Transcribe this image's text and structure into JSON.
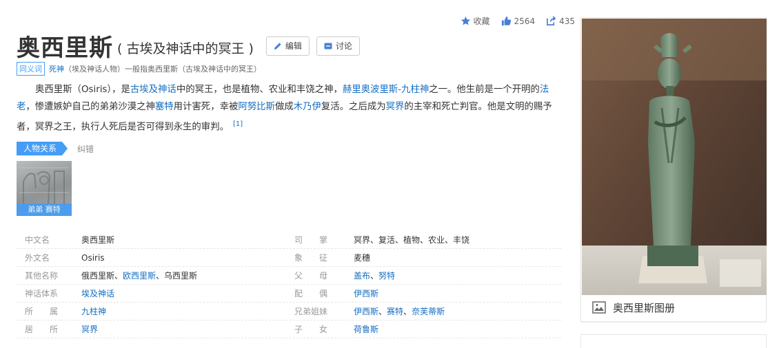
{
  "stats": {
    "favorite_label": "收藏",
    "like_count": "2564",
    "share_count": "435"
  },
  "title": {
    "main": "奥西里斯",
    "sub": "( 古埃及神话中的冥王 )",
    "edit_label": "编辑",
    "discuss_label": "讨论"
  },
  "synonym": {
    "badge": "同义词",
    "link": "死神",
    "text": "（埃及神话人物）一般指奥西里斯（古埃及神话中的冥王）"
  },
  "summary": {
    "segments": [
      {
        "text": "奥西里斯（Osiris），是",
        "link": false
      },
      {
        "text": "古埃及神话",
        "link": true
      },
      {
        "text": "中的冥王，也是植物、农业和丰饶之神，",
        "link": false
      },
      {
        "text": "赫里奥波里斯-九柱神",
        "link": true
      },
      {
        "text": "之一。他生前是一个开明的",
        "link": false
      },
      {
        "text": "法老",
        "link": true
      },
      {
        "text": "，惨遭嫉妒自己的弟弟沙漠之神",
        "link": false
      },
      {
        "text": "塞特",
        "link": true
      },
      {
        "text": "用计害死，幸被",
        "link": false
      },
      {
        "text": "阿努比斯",
        "link": true
      },
      {
        "text": "做成",
        "link": false
      },
      {
        "text": "木乃伊",
        "link": true
      },
      {
        "text": "复活。之后成为",
        "link": false
      },
      {
        "text": "冥界",
        "link": true
      },
      {
        "text": "的主宰和死亡判官。他是文明的赐予者，冥界之王，执行人死后是否可得到永生的审判。",
        "link": false
      }
    ],
    "ref": "[1]"
  },
  "relations": {
    "active_tab": "人物关系",
    "other_tab": "纠错",
    "card_caption": "弟弟 赛特"
  },
  "info": {
    "rows": [
      {
        "l_label": "中文名",
        "l_value": [
          {
            "t": "奥西里斯",
            "link": false
          }
        ],
        "r_label": "司　　掌",
        "r_value": [
          {
            "t": "冥界、复活、植物、农业、丰饶",
            "link": false
          }
        ]
      },
      {
        "l_label": "外文名",
        "l_value": [
          {
            "t": "Osiris",
            "link": false
          }
        ],
        "r_label": "象　　征",
        "r_value": [
          {
            "t": "麦穗",
            "link": false
          }
        ]
      },
      {
        "l_label": "其他名称",
        "l_value": [
          {
            "t": "俄西里斯",
            "link": false
          },
          {
            "t": "、",
            "link": false
          },
          {
            "t": "欧西里斯",
            "link": true
          },
          {
            "t": "、乌西里斯",
            "link": false
          }
        ],
        "r_label": "父　　母",
        "r_value": [
          {
            "t": "盖布",
            "link": true
          },
          {
            "t": "、",
            "link": false
          },
          {
            "t": "努特",
            "link": true
          }
        ]
      },
      {
        "l_label": "神话体系",
        "l_value": [
          {
            "t": "埃及神话",
            "link": true
          }
        ],
        "r_label": "配　　偶",
        "r_value": [
          {
            "t": "伊西斯",
            "link": true
          }
        ]
      },
      {
        "l_label": "所　　属",
        "l_value": [
          {
            "t": "九柱神",
            "link": true
          }
        ],
        "r_label": "兄弟姐妹",
        "r_value": [
          {
            "t": "伊西斯",
            "link": true
          },
          {
            "t": "、",
            "link": false
          },
          {
            "t": "赛特",
            "link": true
          },
          {
            "t": "、",
            "link": false
          },
          {
            "t": "奈芙蒂斯",
            "link": true
          }
        ]
      },
      {
        "l_label": "居　　所",
        "l_value": [
          {
            "t": "冥界",
            "link": true
          }
        ],
        "r_label": "子　　女",
        "r_value": [
          {
            "t": "荷鲁斯",
            "link": true
          }
        ]
      }
    ]
  },
  "album": {
    "caption": "奥西里斯图册"
  },
  "colors": {
    "accent": "#459df5",
    "link": "#136ec2"
  }
}
